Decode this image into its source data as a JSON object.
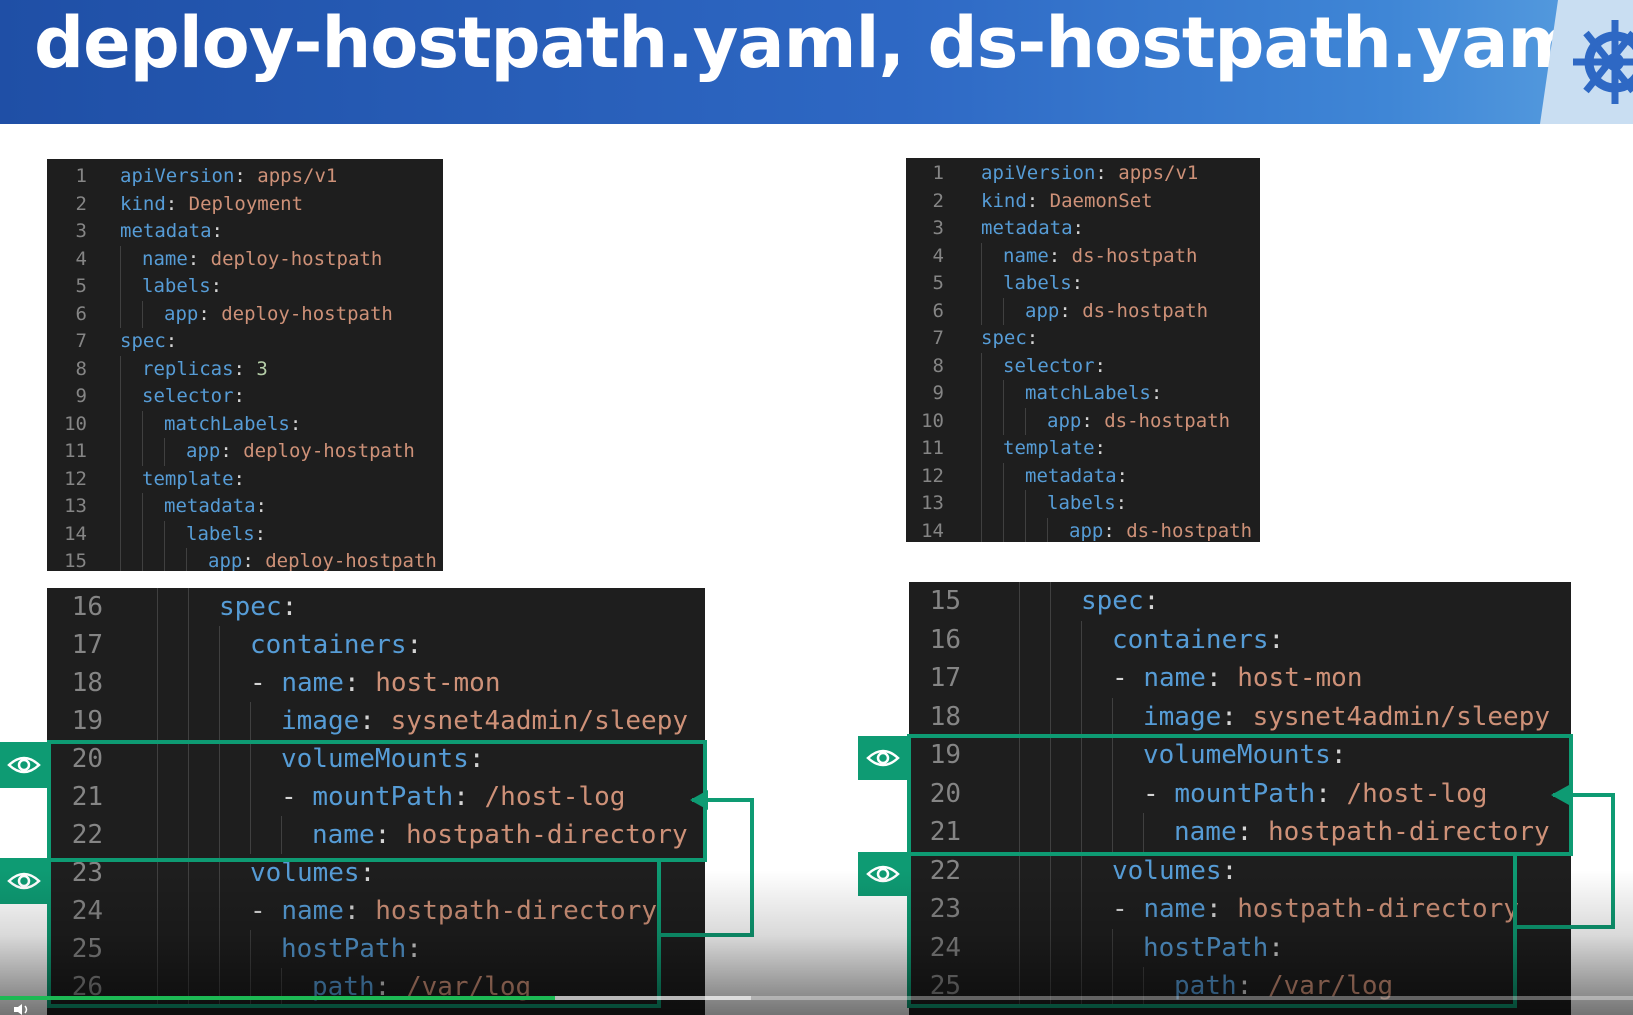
{
  "slide": {
    "title": "deploy-hostpath.yaml, ds-hostpath.yaml",
    "logo_icon": "kubernetes-helm-icon"
  },
  "colors": {
    "banner": "#2e68c4",
    "editor_bg": "#1e1e1e",
    "key": "#569cd6",
    "value": "#ce9178",
    "number": "#b5cea8",
    "punct": "#d4d4d4",
    "line_number": "#858585",
    "highlight": "#0e9b73"
  },
  "left_top_code": [
    {
      "n": "1",
      "indent": 0,
      "key": "apiVersion",
      "value": "apps/v1"
    },
    {
      "n": "2",
      "indent": 0,
      "key": "kind",
      "value": "Deployment"
    },
    {
      "n": "3",
      "indent": 0,
      "key": "metadata",
      "value": ""
    },
    {
      "n": "4",
      "indent": 1,
      "key": "name",
      "value": "deploy-hostpath"
    },
    {
      "n": "5",
      "indent": 1,
      "key": "labels",
      "value": ""
    },
    {
      "n": "6",
      "indent": 2,
      "key": "app",
      "value": "deploy-hostpath"
    },
    {
      "n": "7",
      "indent": 0,
      "key": "spec",
      "value": ""
    },
    {
      "n": "8",
      "indent": 1,
      "key": "replicas",
      "value": "3",
      "num": true
    },
    {
      "n": "9",
      "indent": 1,
      "key": "selector",
      "value": ""
    },
    {
      "n": "10",
      "indent": 2,
      "key": "matchLabels",
      "value": ""
    },
    {
      "n": "11",
      "indent": 3,
      "key": "app",
      "value": "deploy-hostpath"
    },
    {
      "n": "12",
      "indent": 1,
      "key": "template",
      "value": ""
    },
    {
      "n": "13",
      "indent": 2,
      "key": "metadata",
      "value": ""
    },
    {
      "n": "14",
      "indent": 3,
      "key": "labels",
      "value": ""
    },
    {
      "n": "15",
      "indent": 4,
      "key": "app",
      "value": "deploy-hostpath"
    }
  ],
  "left_bottom_code": [
    {
      "n": "16",
      "indent": 2,
      "key": "spec",
      "value": ""
    },
    {
      "n": "17",
      "indent": 3,
      "key": "containers",
      "value": ""
    },
    {
      "n": "18",
      "indent": 3,
      "dash": true,
      "key": "name",
      "value": "host-mon"
    },
    {
      "n": "19",
      "indent": 4,
      "key": "image",
      "value": "sysnet4admin/sleepy"
    },
    {
      "n": "20",
      "indent": 4,
      "key": "volumeMounts",
      "value": ""
    },
    {
      "n": "21",
      "indent": 4,
      "dash": true,
      "key": "mountPath",
      "value": "/host-log"
    },
    {
      "n": "22",
      "indent": 5,
      "key": "name",
      "value": "hostpath-directory"
    },
    {
      "n": "23",
      "indent": 3,
      "key": "volumes",
      "value": ""
    },
    {
      "n": "24",
      "indent": 3,
      "dash": true,
      "key": "name",
      "value": "hostpath-directory"
    },
    {
      "n": "25",
      "indent": 4,
      "key": "hostPath",
      "value": ""
    },
    {
      "n": "26",
      "indent": 5,
      "key": "path",
      "value": "/var/log"
    }
  ],
  "right_top_code": [
    {
      "n": "1",
      "indent": 0,
      "key": "apiVersion",
      "value": "apps/v1"
    },
    {
      "n": "2",
      "indent": 0,
      "key": "kind",
      "value": "DaemonSet"
    },
    {
      "n": "3",
      "indent": 0,
      "key": "metadata",
      "value": ""
    },
    {
      "n": "4",
      "indent": 1,
      "key": "name",
      "value": "ds-hostpath"
    },
    {
      "n": "5",
      "indent": 1,
      "key": "labels",
      "value": ""
    },
    {
      "n": "6",
      "indent": 2,
      "key": "app",
      "value": "ds-hostpath"
    },
    {
      "n": "7",
      "indent": 0,
      "key": "spec",
      "value": ""
    },
    {
      "n": "8",
      "indent": 1,
      "key": "selector",
      "value": ""
    },
    {
      "n": "9",
      "indent": 2,
      "key": "matchLabels",
      "value": ""
    },
    {
      "n": "10",
      "indent": 3,
      "key": "app",
      "value": "ds-hostpath"
    },
    {
      "n": "11",
      "indent": 1,
      "key": "template",
      "value": ""
    },
    {
      "n": "12",
      "indent": 2,
      "key": "metadata",
      "value": ""
    },
    {
      "n": "13",
      "indent": 3,
      "key": "labels",
      "value": ""
    },
    {
      "n": "14",
      "indent": 4,
      "key": "app",
      "value": "ds-hostpath"
    }
  ],
  "right_bottom_code": [
    {
      "n": "15",
      "indent": 2,
      "key": "spec",
      "value": ""
    },
    {
      "n": "16",
      "indent": 3,
      "key": "containers",
      "value": ""
    },
    {
      "n": "17",
      "indent": 3,
      "dash": true,
      "key": "name",
      "value": "host-mon"
    },
    {
      "n": "18",
      "indent": 4,
      "key": "image",
      "value": "sysnet4admin/sleepy"
    },
    {
      "n": "19",
      "indent": 4,
      "key": "volumeMounts",
      "value": ""
    },
    {
      "n": "20",
      "indent": 4,
      "dash": true,
      "key": "mountPath",
      "value": "/host-log"
    },
    {
      "n": "21",
      "indent": 5,
      "key": "name",
      "value": "hostpath-directory"
    },
    {
      "n": "22",
      "indent": 3,
      "key": "volumes",
      "value": ""
    },
    {
      "n": "23",
      "indent": 3,
      "dash": true,
      "key": "name",
      "value": "hostpath-directory"
    },
    {
      "n": "24",
      "indent": 4,
      "key": "hostPath",
      "value": ""
    },
    {
      "n": "25",
      "indent": 5,
      "key": "path",
      "value": "/var/log"
    }
  ],
  "icons": {
    "highlight_marker": "eye-icon",
    "link_arrow": "arrow-left-icon",
    "player_volume": "volume-icon"
  },
  "player": {
    "played_fraction": 0.34,
    "buffered_fraction": 0.46
  }
}
